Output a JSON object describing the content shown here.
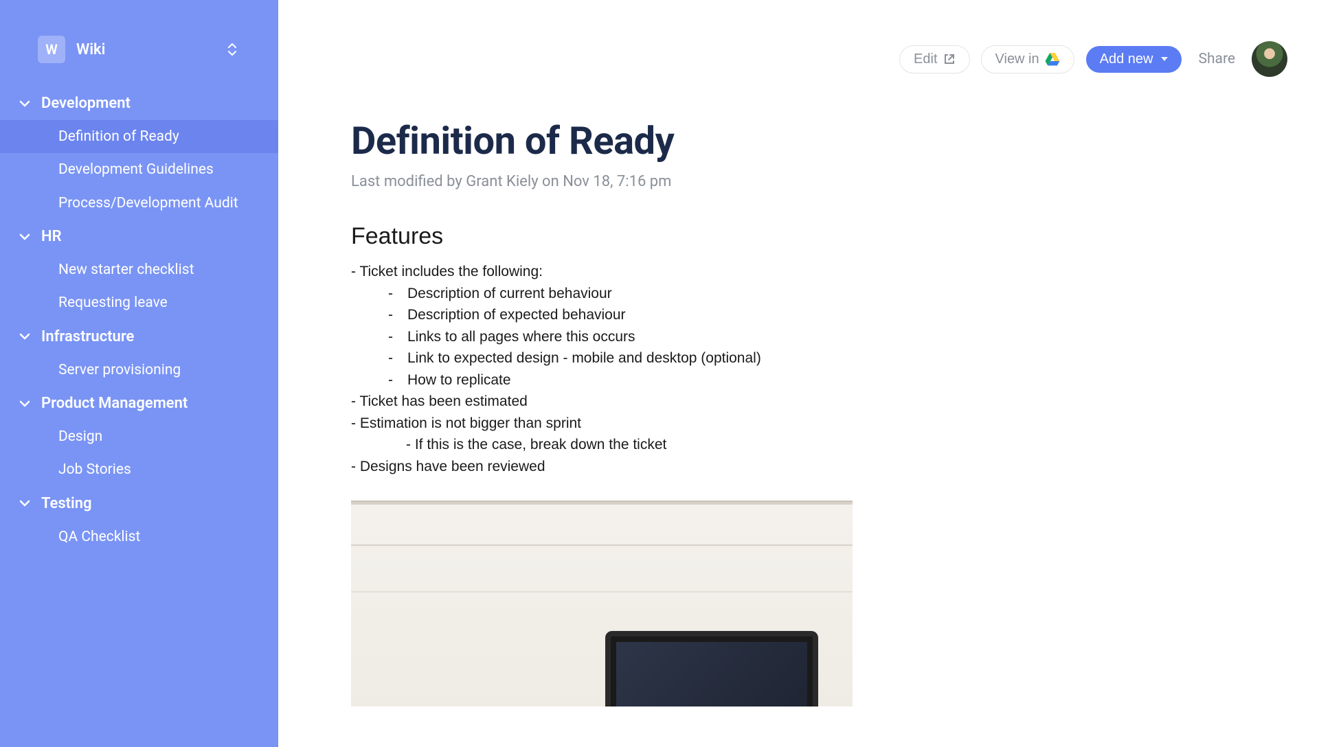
{
  "sidebar": {
    "badge": "W",
    "title": "Wiki",
    "sections": [
      {
        "label": "Development",
        "items": [
          "Definition of Ready",
          "Development Guidelines",
          "Process/Development Audit"
        ]
      },
      {
        "label": "HR",
        "items": [
          "New starter checklist",
          "Requesting leave"
        ]
      },
      {
        "label": "Infrastructure",
        "items": [
          "Server provisioning"
        ]
      },
      {
        "label": "Product Management",
        "items": [
          "Design",
          "Job Stories"
        ]
      },
      {
        "label": "Testing",
        "items": [
          "QA Checklist"
        ]
      }
    ],
    "active": "Definition of Ready"
  },
  "topbar": {
    "edit": "Edit",
    "view_in": "View in",
    "add_new": "Add new",
    "share": "Share"
  },
  "doc": {
    "title": "Definition of Ready",
    "meta": "Last modified by Grant Kiely on Nov 18, 7:16 pm",
    "section": "Features",
    "lines": {
      "a": "- Ticket includes the following:",
      "b": "Description of current behaviour",
      "c": "Description of expected behaviour",
      "d": "Links to all pages where this occurs",
      "e": "Link to expected design - mobile and desktop (optional)",
      "f": "How to replicate",
      "g": "- Ticket has been estimated",
      "h": "- Estimation is not bigger than sprint",
      "i": "- If this is the case, break down the ticket",
      "j": "- Designs have been reviewed"
    }
  }
}
